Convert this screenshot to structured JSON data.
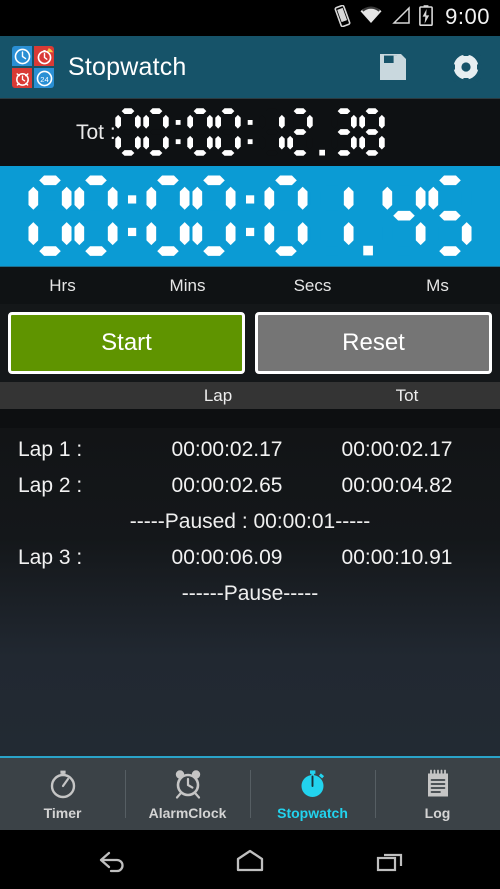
{
  "status_bar": {
    "time": "9:00",
    "icons": [
      "vibrate-icon",
      "wifi-icon",
      "signal-icon",
      "battery-charging-icon"
    ]
  },
  "header": {
    "title": "Stopwatch",
    "app_icon": "clock-tiles-icon",
    "actions": [
      {
        "name": "save-button",
        "icon": "floppy-disk-icon"
      },
      {
        "name": "settings-button",
        "icon": "gear-icon"
      }
    ]
  },
  "total_display": {
    "label": "Tot :",
    "value": "00:00:12.38"
  },
  "main_display": {
    "value": "00:00:01.45",
    "background_color": "#0b9bd4"
  },
  "units": [
    "Hrs",
    "Mins",
    "Secs",
    "Ms"
  ],
  "controls": {
    "start_label": "Start",
    "reset_label": "Reset",
    "start_color": "#5f9400",
    "reset_color": "#757575"
  },
  "lap_table": {
    "headers": {
      "lap": "Lap",
      "tot": "Tot"
    },
    "rows": [
      {
        "type": "lap",
        "name": "Lap 1 :",
        "lap": "00:00:02.17",
        "tot": "00:00:02.17"
      },
      {
        "type": "lap",
        "name": "Lap 2 :",
        "lap": "00:00:02.65",
        "tot": "00:00:04.82"
      },
      {
        "type": "note",
        "text": "-----Paused : 00:00:01-----"
      },
      {
        "type": "lap",
        "name": "Lap 3 :",
        "lap": "00:00:06.09",
        "tot": "00:00:10.91"
      },
      {
        "type": "note",
        "text": "------Pause-----"
      }
    ]
  },
  "tabs": [
    {
      "label": "Timer",
      "icon": "stopwatch-outline-icon",
      "active": false
    },
    {
      "label": "AlarmClock",
      "icon": "alarm-clock-icon",
      "active": false
    },
    {
      "label": "Stopwatch",
      "icon": "stopwatch-filled-icon",
      "active": true
    },
    {
      "label": "Log",
      "icon": "notepad-icon",
      "active": false
    }
  ],
  "nav_bar": {
    "back": "back-icon",
    "home": "home-icon",
    "recents": "recents-icon"
  }
}
